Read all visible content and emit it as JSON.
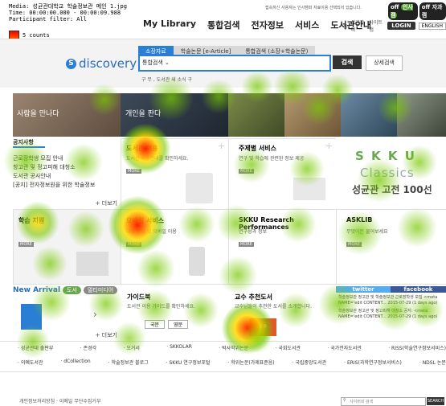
{
  "overlay": {
    "media": "Media: 성균관대학교 학술정보관 메인 1.jpg",
    "time": "Time: 00:00:00.000 - 00:00:09.988",
    "participant": "Participant filter: All",
    "legend_label": "5 counts"
  },
  "topbar": {
    "notice": "접속하신 사용자는 인사캠퍼 자료이용 선택되어 있습니다.",
    "off1": "off",
    "campus1": "인사캠",
    "off2": "off",
    "campus2": "자과캠",
    "links": [
      "홈",
      "성균관대",
      "사이트맵"
    ],
    "login": "LOGIN",
    "english": "ENGLISH"
  },
  "nav": {
    "items": [
      "My Library",
      "통합검색",
      "전자정보",
      "서비스",
      "도서관안내"
    ]
  },
  "search": {
    "logo": "discovery",
    "tabs": [
      "소장자료",
      "학술논문 [e-Article]",
      "통합검색 (소장+학술논문)"
    ],
    "scope": "통합검색",
    "submit": "검색",
    "advanced": "상세검색",
    "hint": "구 무 ,   도서관 새 소식 구"
  },
  "banner": {
    "tiles": [
      "사람을 만나다",
      "개인을 판다",
      "",
      "",
      "",
      ""
    ]
  },
  "notices": {
    "tab": "공지사항",
    "items": [
      "근로장학생 모집 안내",
      "창고관 및 정고피해 대청소",
      "도서관 공사안내",
      "[공지] 전자정보원을 위한 학술정보"
    ],
    "more": "+ 더보기"
  },
  "cards": [
    {
      "title": "도서관 이용",
      "desc": "도서관 이용안내를 확인하세요.",
      "badge": "MORE"
    },
    {
      "title": "주제별 서비스",
      "desc": "연구 및 학습에 관련된 정보 제공",
      "badge": "MORE"
    },
    {
      "title": "학습 지원",
      "desc": "학습 지원 서비스 안내",
      "badge": "MORE"
    },
    {
      "title": "모바일 서비스",
      "desc": "대출 반납 및 모바일 이용",
      "badge": "MORE"
    },
    {
      "title": "SKKU Research Performances",
      "desc": "연구성과 정보",
      "badge": "MORE"
    },
    {
      "title": "ASKLIB",
      "desc": "무엇이든 물어보세요",
      "badge": "MORE"
    }
  ],
  "classics": {
    "line1": "S K K U",
    "line2": "Classics",
    "line3": "성균관 고전 100선"
  },
  "new_arrival": {
    "title": "New Arrival",
    "tab1": "도서",
    "tab2": "멀티미디어",
    "more": "+ 더보기"
  },
  "guide": {
    "title": "가이드북",
    "desc": "도서관 이용 가이드를 확인하세요.",
    "btn1": "국문",
    "btn2": "영문"
  },
  "ebook": {
    "title": "교수 추천도서",
    "desc": "교수님들이 추천한 도서를 소개합니다.",
    "label": "교수"
  },
  "social": {
    "tab1": "twitter",
    "tab2": "facebook",
    "post1": "학술정보관 정고관 및 학술정보관 근로장학생 모집 <meta NAME='edit CONTENT... 2015-07-29 (1 days ago)",
    "post2": "학술정보관 정고관 및 정고피해 대청소 공지: <meta NAME='edit CONTENT... 2015-07-29 (1 days ago)"
  },
  "footer_links": {
    "row1": [
      "· 성균관대 출판부",
      "· 존경각",
      "· 오거서",
      "· SKKOLAR",
      "· 박사학위논문",
      "· 국회도서관",
      "· 국가전자도서관",
      "· RISS(학술연구정보서비스)"
    ],
    "row2": [
      "· 의예도서관",
      "· dCollection",
      "· 학술정보관 블로그",
      "· SKKU 연구정보포털",
      "· 학위논문(가제표준음)",
      "· 국립중앙도서관",
      "· ERIS(과학연구정보서비스)",
      "· NDSL 논문"
    ]
  },
  "footer": {
    "policy": "개인정보처리방침 · 이메일 무단수집거부",
    "search_placeholder": "사이버네 검색",
    "search_btn": "SEARCH"
  }
}
